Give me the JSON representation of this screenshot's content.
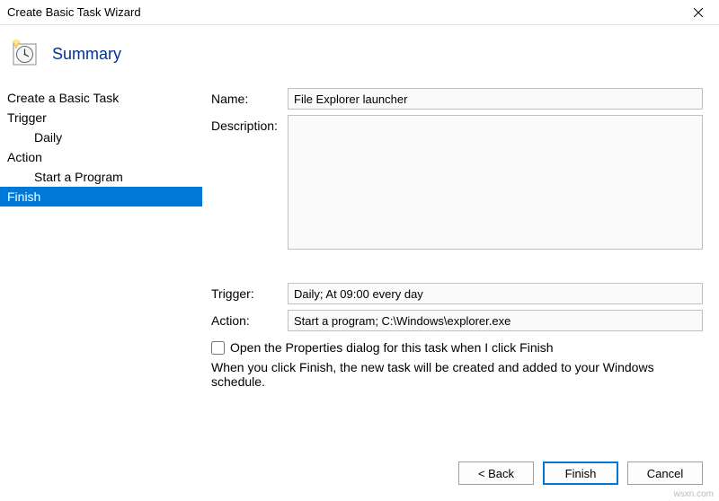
{
  "window": {
    "title": "Create Basic Task Wizard"
  },
  "header": {
    "title": "Summary"
  },
  "sidebar": {
    "items": [
      {
        "label": "Create a Basic Task",
        "indent": false,
        "selected": false
      },
      {
        "label": "Trigger",
        "indent": false,
        "selected": false
      },
      {
        "label": "Daily",
        "indent": true,
        "selected": false
      },
      {
        "label": "Action",
        "indent": false,
        "selected": false
      },
      {
        "label": "Start a Program",
        "indent": true,
        "selected": false
      },
      {
        "label": "Finish",
        "indent": false,
        "selected": true
      }
    ]
  },
  "form": {
    "name_label": "Name:",
    "name_value": "File Explorer launcher",
    "description_label": "Description:",
    "description_value": "",
    "trigger_label": "Trigger:",
    "trigger_value": "Daily; At 09:00 every day",
    "action_label": "Action:",
    "action_value": "Start a program; C:\\Windows\\explorer.exe",
    "checkbox_label": "Open the Properties dialog for this task when I click Finish",
    "checkbox_checked": false,
    "info_text": "When you click Finish, the new task will be created and added to your Windows schedule."
  },
  "buttons": {
    "back": "< Back",
    "finish": "Finish",
    "cancel": "Cancel"
  },
  "watermark": "wsxn.com"
}
